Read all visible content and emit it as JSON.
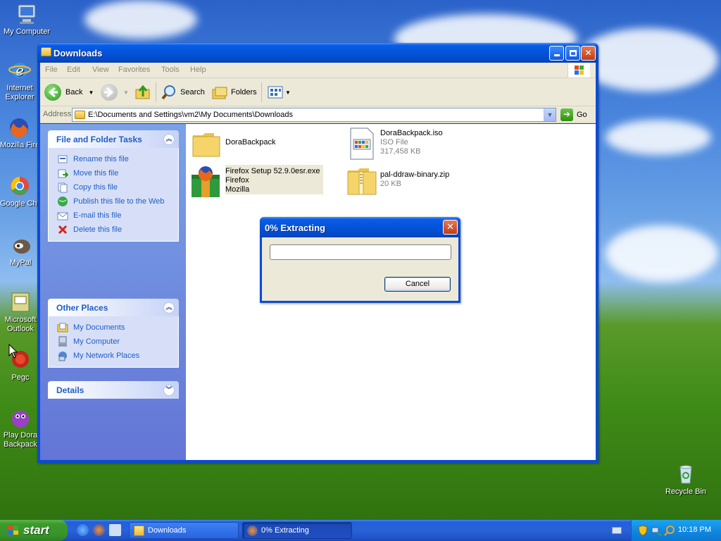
{
  "desktop": {
    "icons": [
      {
        "label": "My Computer"
      },
      {
        "label": "Internet Explorer"
      },
      {
        "label": "Mozilla Firefox"
      },
      {
        "label": "Google Chrome"
      },
      {
        "label": "MyPal"
      },
      {
        "label": "Microsoft Outlook"
      },
      {
        "label": "Pegc"
      },
      {
        "label": "Play Dora Backpack"
      },
      {
        "label": "Recycle Bin"
      }
    ]
  },
  "explorer": {
    "title": "Downloads",
    "menu": [
      "File",
      "Edit",
      "View",
      "Favorites",
      "Tools",
      "Help"
    ],
    "toolbar": {
      "back": "Back",
      "search": "Search",
      "folders": "Folders"
    },
    "address": {
      "label": "Address",
      "value": "E:\\Documents and Settings\\vm2\\My Documents\\Downloads",
      "go": "Go"
    },
    "tasks": {
      "file_folder": {
        "title": "File and Folder Tasks",
        "items": [
          "Rename this file",
          "Move this file",
          "Copy this file",
          "Publish this file to the Web",
          "E-mail this file",
          "Delete this file"
        ]
      },
      "other_places": {
        "title": "Other Places",
        "items": [
          "My Documents",
          "My Computer",
          "My Network Places"
        ]
      },
      "details": {
        "title": "Details"
      }
    },
    "files": [
      {
        "name": "DoraBackpack",
        "type": "",
        "size": ""
      },
      {
        "name": "DoraBackpack.iso",
        "type": "ISO File",
        "size": "317,458 KB"
      },
      {
        "name": "Firefox Setup 52.9.0esr.exe",
        "type": "Firefox",
        "size": "Mozilla"
      },
      {
        "name": "pal-ddraw-binary.zip",
        "type": "",
        "size": "20 KB"
      }
    ]
  },
  "dialog": {
    "title": "0% Extracting",
    "progress": 0,
    "cancel": "Cancel"
  },
  "taskbar": {
    "start": "start",
    "tasks": [
      {
        "label": "Downloads"
      },
      {
        "label": "0% Extracting"
      }
    ],
    "clock": "10:18 PM"
  }
}
